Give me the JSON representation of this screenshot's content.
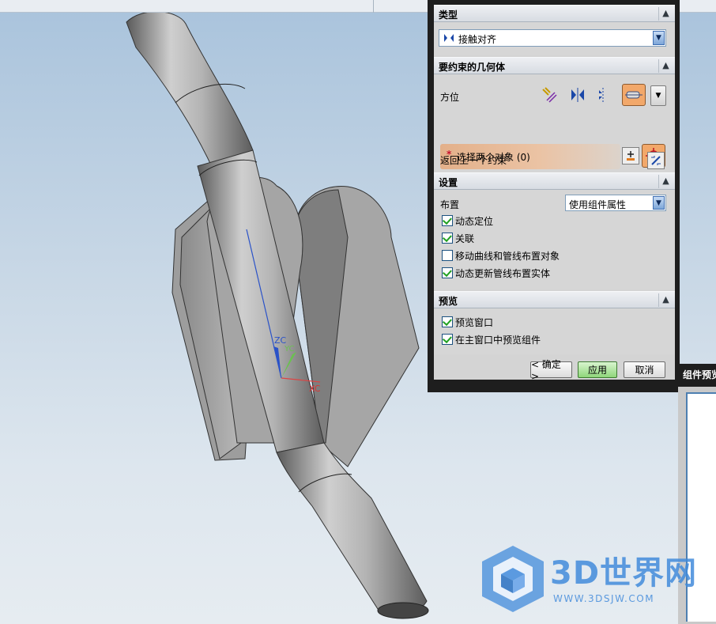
{
  "dialog": {
    "type_section": {
      "title": "类型",
      "value": "接触对齐"
    },
    "geometry_section": {
      "title": "要约束的几何体",
      "orientation_label": "方位",
      "select_prompt": "选择两个对象 (0)",
      "return_label": "返回上一个约束"
    },
    "settings_section": {
      "title": "设置",
      "layout_label": "布置",
      "layout_value": "使用组件属性",
      "checkboxes": [
        {
          "label": "动态定位",
          "checked": true
        },
        {
          "label": "关联",
          "checked": true
        },
        {
          "label": "移动曲线和管线布置对象",
          "checked": false
        },
        {
          "label": "动态更新管线布置实体",
          "checked": true
        }
      ]
    },
    "preview_section": {
      "title": "预览",
      "checkboxes": [
        {
          "label": "预览窗口",
          "checked": true
        },
        {
          "label": "在主窗口中预览组件",
          "checked": true
        }
      ]
    },
    "buttons": {
      "ok": "< 确定 >",
      "apply": "应用",
      "cancel": "取消"
    }
  },
  "side_panel": {
    "title": "组件预览"
  },
  "axes": {
    "zc": "ZC",
    "yc": "YC",
    "xc": "XC"
  },
  "watermark": {
    "brand": "3D世界网",
    "url": "WWW.3DSJW.COM"
  }
}
